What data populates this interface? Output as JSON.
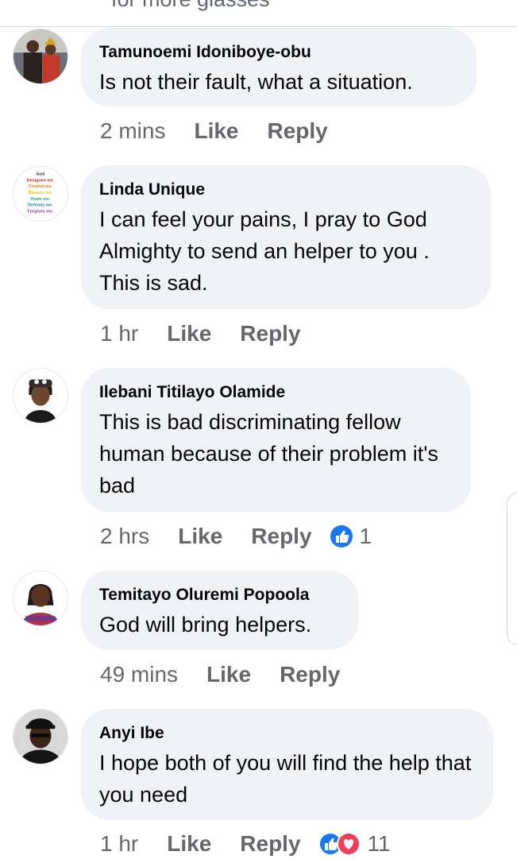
{
  "comments": [
    {
      "author": "Tamunoemi Idoniboye-obu",
      "text": "Is not their fault, what a situation.",
      "time": "2 mins",
      "like": "Like",
      "reply": "Reply"
    },
    {
      "author": "Linda Unique",
      "text": "I can feel your pains, I pray to God Almighty to send an helper to you . This is sad.",
      "time": "1 hr",
      "like": "Like",
      "reply": "Reply",
      "avatar_text": [
        "God",
        "Designed me.",
        "Created me.",
        "Blesses me.",
        "Heals me.",
        "Defends me.",
        "Forgives me."
      ]
    },
    {
      "author": "Ilebani Titilayo Olamide",
      "text": "This is bad discriminating fellow human because of their problem it's bad",
      "time": "2 hrs",
      "like": "Like",
      "reply": "Reply",
      "reaction_count": "1",
      "reaction_icons": [
        "like-icon"
      ]
    },
    {
      "author": "Temitayo Oluremi Popoola",
      "text": "God will bring helpers.",
      "time": "49 mins",
      "like": "Like",
      "reply": "Reply"
    },
    {
      "author": "Anyi Ibe",
      "text": "I hope both of you will find the help that you need",
      "time": "1 hr",
      "like": "Like",
      "reply": "Reply",
      "reaction_count": "11",
      "reaction_icons": [
        "like-icon",
        "love-icon"
      ]
    }
  ],
  "colors": {
    "bubble": "#f0f2f5",
    "meta_text": "#65676b",
    "like_blue": "#1877f2",
    "love_red": "#f33e58"
  }
}
